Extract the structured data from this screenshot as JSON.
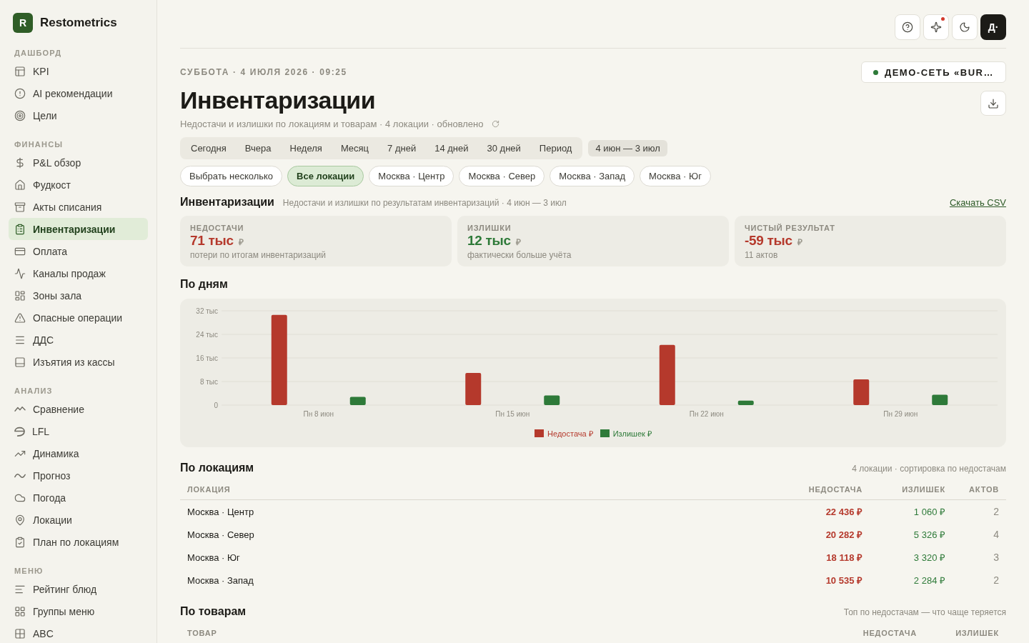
{
  "sidebar": {
    "logo": {
      "letter": "R",
      "name": "Restometrics"
    },
    "sections": [
      {
        "title": "ДАШБОРД",
        "items": [
          {
            "label": "KPI",
            "selected": false
          },
          {
            "label": "AI рекомендации",
            "selected": false
          },
          {
            "label": "Цели",
            "selected": false
          }
        ]
      },
      {
        "title": "ФИНАНСЫ",
        "items": [
          {
            "label": "P&L обзор",
            "selected": false
          },
          {
            "label": "Фудкост",
            "selected": false
          },
          {
            "label": "Акты списания",
            "selected": false
          },
          {
            "label": "Инвентаризации",
            "selected": true
          },
          {
            "label": "Оплата",
            "selected": false
          },
          {
            "label": "Каналы продаж",
            "selected": false
          },
          {
            "label": "Зоны зала",
            "selected": false
          },
          {
            "label": "Опасные операции",
            "selected": false
          },
          {
            "label": "ДДС",
            "selected": false
          },
          {
            "label": "Изъятия из кассы",
            "selected": false
          }
        ]
      },
      {
        "title": "АНАЛИЗ",
        "items": [
          {
            "label": "Сравнение",
            "selected": false
          },
          {
            "label": "LFL",
            "selected": false
          },
          {
            "label": "Динамика",
            "selected": false
          },
          {
            "label": "Прогноз",
            "selected": false
          },
          {
            "label": "Погода",
            "selected": false
          },
          {
            "label": "Локации",
            "selected": false
          },
          {
            "label": "План по локациям",
            "selected": false
          }
        ]
      },
      {
        "title": "МЕНЮ",
        "items": [
          {
            "label": "Рейтинг блюд",
            "selected": false
          },
          {
            "label": "Группы меню",
            "selected": false
          },
          {
            "label": "ABC",
            "selected": false
          }
        ]
      }
    ]
  },
  "top_actions": [
    {
      "notification": false
    },
    {
      "notification": true
    },
    {
      "notification": false
    }
  ],
  "avatar": "Д·",
  "header": {
    "date": "СУББОТА · 4 ИЮЛЯ 2026 · 09:25",
    "title": "Инвентаризации",
    "subtitle": "Недостачи и излишки по локациям и товарам · 4 локации · обновлено",
    "workspace": "ДЕМО-СЕТЬ «BUR…"
  },
  "period_tabs": [
    {
      "label": "Сегодня",
      "selected": false
    },
    {
      "label": "Вчера",
      "selected": false
    },
    {
      "label": "Неделя",
      "selected": false
    },
    {
      "label": "Месяц",
      "selected": false
    },
    {
      "label": "7 дней",
      "selected": false
    },
    {
      "label": "14 дней",
      "selected": false
    },
    {
      "label": "30 дней",
      "selected": false
    },
    {
      "label": "Период",
      "selected": false
    }
  ],
  "date_range": "4 июн — 3 июл",
  "location_chips": [
    {
      "label": "Выбрать несколько",
      "selected": false
    },
    {
      "label": "Все локации",
      "selected": true
    },
    {
      "label": "Москва · Центр",
      "selected": false
    },
    {
      "label": "Москва · Север",
      "selected": false
    },
    {
      "label": "Москва · Запад",
      "selected": false
    },
    {
      "label": "Москва · Юг",
      "selected": false
    }
  ],
  "summary": {
    "title": "Инвентаризации",
    "subtitle": "Недостачи и излишки по результатам инвентаризаций · 4 июн — 3 июл",
    "link": "Скачать CSV",
    "cards": [
      {
        "label": "НЕДОСТАЧИ",
        "value": "71 тыс",
        "currency": "₽",
        "note": "потери по итогам инвентаризаций",
        "color": "#b5392c"
      },
      {
        "label": "ИЗЛИШКИ",
        "value": "12 тыс",
        "currency": "₽",
        "note": "фактически больше учёта",
        "color": "#2e7a39"
      },
      {
        "label": "ЧИСТЫЙ РЕЗУЛЬТАТ",
        "value": "-59 тыс",
        "currency": "₽",
        "note": "11 актов",
        "color": "#b5392c"
      }
    ]
  },
  "by_day": {
    "title": "По дням",
    "chart_data": {
      "type": "bar",
      "categories": [
        "Пн 8 июн",
        "Пн 15 июн",
        "Пн 22 июн",
        "Пн 29 июн"
      ],
      "series": [
        {
          "name": "Недостача ₽",
          "color": "#b5392c",
          "values": [
            30.6,
            10.9,
            20.4,
            8.7
          ]
        },
        {
          "name": "Излишек ₽",
          "color": "#2e7a39",
          "values": [
            2.8,
            3.3,
            1.5,
            3.5
          ]
        }
      ],
      "ylim": [
        0,
        32
      ],
      "yticks": [
        {
          "value": 0,
          "label": "0"
        },
        {
          "value": 8,
          "label": "8 тыс"
        },
        {
          "value": 16,
          "label": "16 тыс"
        },
        {
          "value": 24,
          "label": "24 тыс"
        },
        {
          "value": 32,
          "label": "32 тыс"
        }
      ],
      "grid": true,
      "legend": "bottom"
    }
  },
  "by_location": {
    "title": "По локациям",
    "note": "4 локации · сортировка по недостачам",
    "columns": [
      "ЛОКАЦИЯ",
      "НЕДОСТАЧА",
      "ИЗЛИШЕК",
      "АКТОВ"
    ],
    "rows": [
      {
        "location": "Москва · Центр",
        "shortage": "22 436 ₽",
        "surplus": "1 060 ₽",
        "acts": "2"
      },
      {
        "location": "Москва · Север",
        "shortage": "20 282 ₽",
        "surplus": "5 326 ₽",
        "acts": "4"
      },
      {
        "location": "Москва · Юг",
        "shortage": "18 118 ₽",
        "surplus": "3 320 ₽",
        "acts": "3"
      },
      {
        "location": "Москва · Запад",
        "shortage": "10 535 ₽",
        "surplus": "2 284 ₽",
        "acts": "2"
      }
    ]
  },
  "by_product": {
    "title": "По товарам",
    "note": "Топ по недостачам — что чаще теряется",
    "columns": [
      "ТОВАР",
      "НЕДОСТАЧА",
      "ИЗЛИШЕК"
    ]
  }
}
